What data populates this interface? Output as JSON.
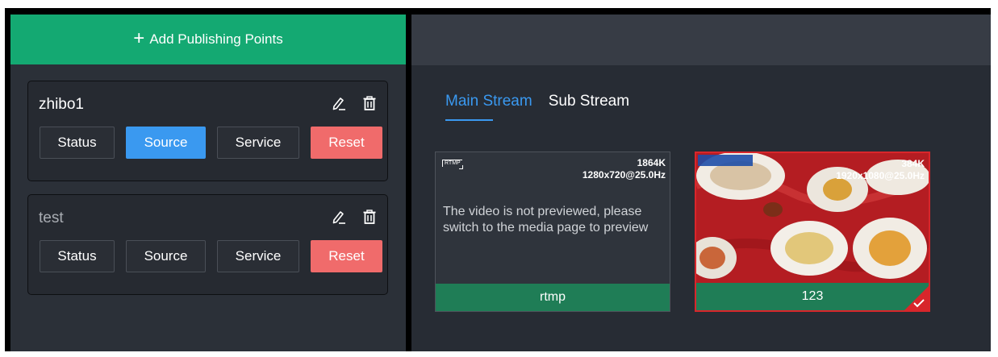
{
  "header": {
    "add_label": "Add Publishing Points"
  },
  "publishing_points": [
    {
      "name": "zhibo1",
      "buttons": {
        "status": "Status",
        "source": "Source",
        "service": "Service",
        "reset": "Reset"
      },
      "active": "source"
    },
    {
      "name": "test",
      "buttons": {
        "status": "Status",
        "source": "Source",
        "service": "Service",
        "reset": "Reset"
      },
      "active": "none"
    }
  ],
  "tabs": [
    {
      "label": "Main Stream",
      "active": true
    },
    {
      "label": "Sub Stream",
      "active": false
    }
  ],
  "streams": [
    {
      "tag": "RTMP",
      "bitrate": "1864K",
      "resolution": "1280x720@25.0Hz",
      "message": "The video is not previewed, please switch to the media page to preview",
      "name": "rtmp",
      "selected": false
    },
    {
      "bitrate": "384K",
      "resolution": "1920x1080@25.0Hz",
      "name": "123",
      "selected": true
    }
  ],
  "colors": {
    "accent_green": "#14a972",
    "accent_blue": "#3a99f0",
    "reset_red": "#f06b6b",
    "selected_red": "#d8262b",
    "footer_green": "#1f7d56"
  },
  "icons": {
    "add": "plus-icon",
    "edit": "pencil-icon",
    "delete": "trash-icon",
    "selected": "check-icon"
  }
}
